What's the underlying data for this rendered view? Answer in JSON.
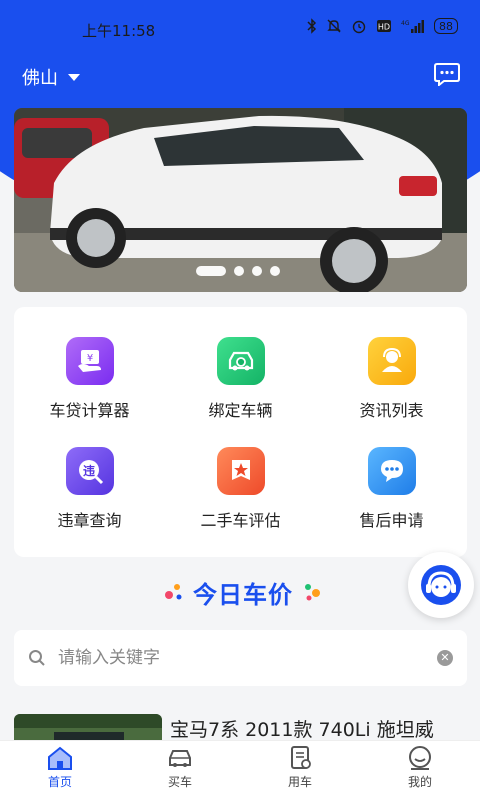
{
  "status_bar": {
    "time": "上午11:58",
    "network": "4G",
    "battery": "88"
  },
  "header": {
    "city": "佛山",
    "message_icon": "chat-bubble-icon"
  },
  "banner": {
    "slide_count": 4,
    "active_index": 0
  },
  "services": [
    {
      "label": "车贷计算器",
      "icon": "loan-calculator-icon",
      "color": "#8a3cf0"
    },
    {
      "label": "绑定车辆",
      "icon": "bind-car-icon",
      "color": "#1fc173"
    },
    {
      "label": "资讯列表",
      "icon": "news-list-icon",
      "color": "#fdb712"
    },
    {
      "label": "违章查询",
      "icon": "violation-query-icon",
      "color": "#6b4af0"
    },
    {
      "label": "二手车评估",
      "icon": "used-car-evaluation-icon",
      "color": "#f5613a"
    },
    {
      "label": "售后申请",
      "icon": "after-sales-icon",
      "color": "#2f8ff5"
    }
  ],
  "section": {
    "title": "今日车价"
  },
  "search": {
    "placeholder": "请输入关键字"
  },
  "news": [
    {
      "title": "宝马7系 2011款 740Li 施坦威"
    }
  ],
  "tabs": [
    {
      "label": "首页",
      "icon": "home-icon",
      "active": true
    },
    {
      "label": "买车",
      "icon": "car-icon",
      "active": false
    },
    {
      "label": "用车",
      "icon": "document-icon",
      "active": false
    },
    {
      "label": "我的",
      "icon": "profile-icon",
      "active": false
    }
  ],
  "colors": {
    "brand": "#1a4fee",
    "background": "#f4f5f7"
  }
}
